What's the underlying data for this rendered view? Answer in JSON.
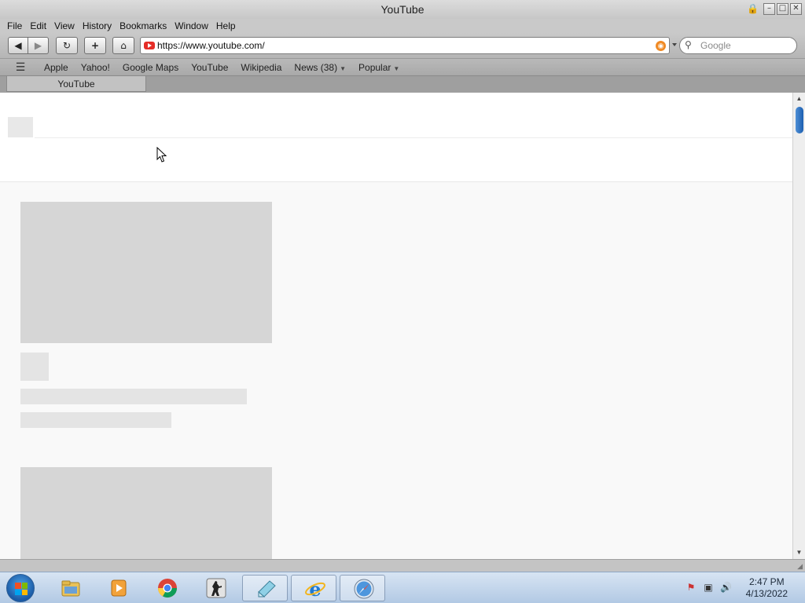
{
  "window": {
    "title": "YouTube",
    "controls": {
      "minimize": "–",
      "maximize": "□",
      "close": "✕"
    }
  },
  "menu": [
    "File",
    "Edit",
    "View",
    "History",
    "Bookmarks",
    "Window",
    "Help"
  ],
  "toolbar": {
    "back_glyph": "◀",
    "forward_glyph": "▶",
    "reload_glyph": "↻",
    "add_glyph": "+",
    "home_glyph": "⌂",
    "url": "https://www.youtube.com/",
    "search_placeholder": "Google",
    "search_glyph": "⚲"
  },
  "bookmarks": {
    "items": [
      "Apple",
      "Yahoo!",
      "Google Maps",
      "YouTube",
      "Wikipedia",
      "News (38)",
      "Popular"
    ],
    "dropdown_items": [
      "News (38)",
      "Popular"
    ],
    "book_glyph": "📖"
  },
  "tabs": [
    {
      "label": "YouTube",
      "active": true
    }
  ],
  "taskbar": {
    "apps": [
      {
        "name": "windows-explorer",
        "active": false
      },
      {
        "name": "media-player",
        "active": false
      },
      {
        "name": "chrome",
        "active": false
      },
      {
        "name": "counter-strike",
        "active": false
      },
      {
        "name": "notepad",
        "active": true
      },
      {
        "name": "internet-explorer",
        "active": true
      },
      {
        "name": "safari",
        "active": true
      }
    ],
    "clock": {
      "time": "2:47 PM",
      "date": "4/13/2022"
    }
  },
  "colors": {
    "youtube_red": "#e52d27",
    "rss_orange": "#f08a24",
    "placeholder_gray": "#d6d6d6",
    "scroll_thumb": "#2b6fc0"
  }
}
